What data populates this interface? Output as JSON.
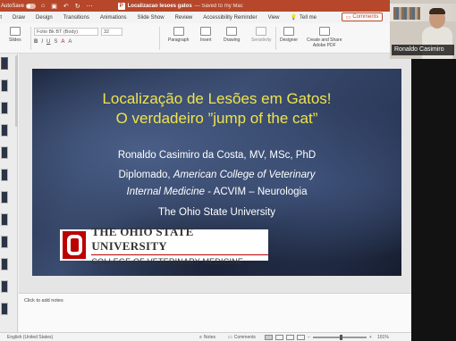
{
  "window": {
    "autosave_label": "AutoSave",
    "autosave_state": "off",
    "doc_title": "Localizacao lesoes gatos",
    "doc_status": "— Saved to my Mac",
    "brand_color": "#b7472a"
  },
  "menu": {
    "tabs": [
      "art",
      "Draw",
      "Design",
      "Transitions",
      "Animations",
      "Slide Show",
      "Review",
      "Accessibility Reminder",
      "View"
    ],
    "tell_me": "Tell me",
    "comments": "Comments"
  },
  "ribbon": {
    "slides_label": "Slides",
    "font_name": "Folio Bk BT (Body)",
    "font_size": "32",
    "paragraph_label": "Paragraph",
    "insert_label": "Insert",
    "drawing_label": "Drawing",
    "sensitivity_label": "Sensitivity",
    "designer_label": "Designer",
    "create_share_label": "Create and Share",
    "adobe_pdf_label": "Adobe PDF"
  },
  "slide": {
    "title_line1": "Localização de Lesões em Gatos!",
    "title_line2": "O verdadeiro ”jump of the cat”",
    "author": "Ronaldo Casimiro da Costa, MV, MSc, PhD",
    "diploma_prefix": "Diplomado, ",
    "diploma_college": "American College of Veterinary",
    "internal_medicine": "Internal Medicine",
    "acvim": " - ACVIM – Neurologia",
    "university": "The Ohio State University",
    "logo_name": "THE OHIO STATE UNIVERSITY",
    "logo_college": "COLLEGE OF VETERINARY MEDICINE",
    "title_color": "#f0e44a"
  },
  "notes": {
    "placeholder": "Click to add notes"
  },
  "status": {
    "language": "English (United States)",
    "notes": "Notes",
    "comments": "Comments",
    "zoom": "101%"
  },
  "video": {
    "participant_name": "Ronaldo Casimiro"
  }
}
